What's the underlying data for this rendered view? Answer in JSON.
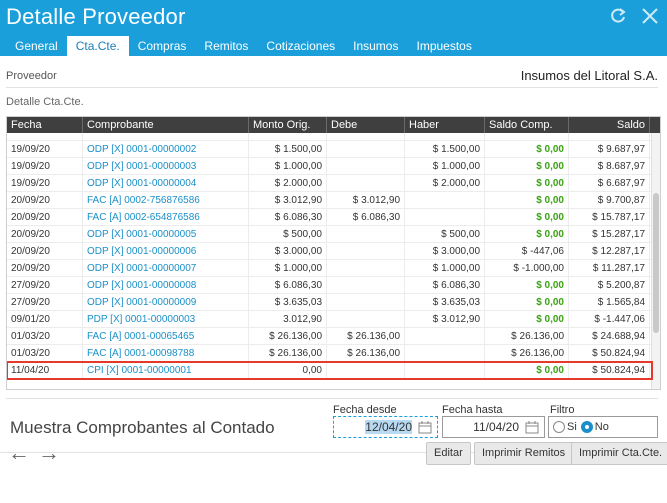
{
  "window": {
    "title": "Detalle Proveedor",
    "refresh_icon": "refresh-icon",
    "close_icon": "close-icon"
  },
  "tabs": [
    {
      "label": "General",
      "active": false
    },
    {
      "label": "Cta.Cte.",
      "active": true
    },
    {
      "label": "Compras",
      "active": false
    },
    {
      "label": "Remitos",
      "active": false
    },
    {
      "label": "Cotizaciones",
      "active": false
    },
    {
      "label": "Insumos",
      "active": false
    },
    {
      "label": "Impuestos",
      "active": false
    }
  ],
  "proveedor": {
    "label": "Proveedor",
    "value": "Insumos del Litoral S.A."
  },
  "section_label": "Detalle Cta.Cte.",
  "table": {
    "columns": [
      "Fecha",
      "Comprobante",
      "Monto Orig.",
      "Debe",
      "Haber",
      "Saldo Comp.",
      "Saldo"
    ],
    "rows": [
      {
        "fecha": "19/09/20",
        "comprobante": "ODP [X] 0001-00000002",
        "monto": "$ 1.500,00",
        "debe": "",
        "haber": "$ 1.500,00",
        "saldo_comp": "$ 0,00",
        "saldo": "$ 9.687,97"
      },
      {
        "fecha": "19/09/20",
        "comprobante": "ODP [X] 0001-00000003",
        "monto": "$ 1.000,00",
        "debe": "",
        "haber": "$ 1.000,00",
        "saldo_comp": "$ 0,00",
        "saldo": "$ 8.687,97"
      },
      {
        "fecha": "19/09/20",
        "comprobante": "ODP [X] 0001-00000004",
        "monto": "$ 2.000,00",
        "debe": "",
        "haber": "$ 2.000,00",
        "saldo_comp": "$ 0,00",
        "saldo": "$ 6.687,97"
      },
      {
        "fecha": "20/09/20",
        "comprobante": "FAC [A] 0002-756876586",
        "monto": "$ 3.012,90",
        "debe": "$ 3.012,90",
        "haber": "",
        "saldo_comp": "$ 0,00",
        "saldo": "$ 9.700,87"
      },
      {
        "fecha": "20/09/20",
        "comprobante": "FAC [A] 0002-654876586",
        "monto": "$ 6.086,30",
        "debe": "$ 6.086,30",
        "haber": "",
        "saldo_comp": "$ 0,00",
        "saldo": "$ 15.787,17"
      },
      {
        "fecha": "20/09/20",
        "comprobante": "ODP [X] 0001-00000005",
        "monto": "$ 500,00",
        "debe": "",
        "haber": "$ 500,00",
        "saldo_comp": "$ 0,00",
        "saldo": "$ 15.287,17"
      },
      {
        "fecha": "20/09/20",
        "comprobante": "ODP [X] 0001-00000006",
        "monto": "$ 3.000,00",
        "debe": "",
        "haber": "$ 3.000,00",
        "saldo_comp": "$ -447,06",
        "saldo": "$ 12.287,17"
      },
      {
        "fecha": "20/09/20",
        "comprobante": "ODP [X] 0001-00000007",
        "monto": "$ 1.000,00",
        "debe": "",
        "haber": "$ 1.000,00",
        "saldo_comp": "$ -1.000,00",
        "saldo": "$ 11.287,17"
      },
      {
        "fecha": "27/09/20",
        "comprobante": "ODP [X] 0001-00000008",
        "monto": "$ 6.086,30",
        "debe": "",
        "haber": "$ 6.086,30",
        "saldo_comp": "$ 0,00",
        "saldo": "$ 5.200,87"
      },
      {
        "fecha": "27/09/20",
        "comprobante": "ODP [X] 0001-00000009",
        "monto": "$ 3.635,03",
        "debe": "",
        "haber": "$ 3.635,03",
        "saldo_comp": "$ 0,00",
        "saldo": "$ 1.565,84"
      },
      {
        "fecha": "09/01/20",
        "comprobante": "PDP [X] 0001-00000003",
        "monto": "3.012,90",
        "debe": "",
        "haber": "$ 3.012,90",
        "saldo_comp": "$ 0,00",
        "saldo": "$ -1.447,06"
      },
      {
        "fecha": "01/03/20",
        "comprobante": "FAC [A] 0001-00065465",
        "monto": "$ 26.136,00",
        "debe": "$ 26.136,00",
        "haber": "",
        "saldo_comp": "$ 26.136,00",
        "saldo": "$ 24.688,94"
      },
      {
        "fecha": "01/03/20",
        "comprobante": "FAC [A] 0001-00098788",
        "monto": "$ 26.136,00",
        "debe": "$ 26.136,00",
        "haber": "",
        "saldo_comp": "$ 26.136,00",
        "saldo": "$ 50.824,94"
      },
      {
        "fecha": "11/04/20",
        "comprobante": "CPI [X] 0001-00000001",
        "monto": "0,00",
        "debe": "",
        "haber": "",
        "saldo_comp": "$ 0,00",
        "saldo": "$ 50.824,94"
      }
    ]
  },
  "contado": {
    "label": "Muestra Comprobantes al Contado"
  },
  "filters": {
    "fecha_desde_label": "Fecha desde",
    "fecha_desde_value": "12/04/20",
    "fecha_hasta_label": "Fecha hasta",
    "fecha_hasta_value": "11/04/20",
    "filtro_label": "Filtro",
    "filtro_si": "Si",
    "filtro_no": "No",
    "filtro_selected": "No"
  },
  "footer": {
    "back_icon": "arrow-left-icon",
    "forward_icon": "arrow-right-icon",
    "editar": "Editar",
    "imprimir_remitos": "Imprimir Remitos",
    "imprimir_ctacte": "Imprimir Cta.Cte."
  },
  "colors": {
    "header_bg": "#1a9fdb",
    "link": "#1a8fc9",
    "green": "#3aa312",
    "highlight": "#e53a2b"
  }
}
